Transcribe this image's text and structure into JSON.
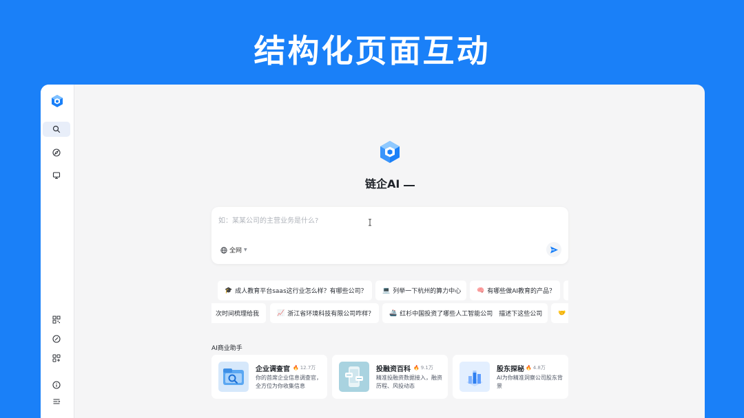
{
  "banner": {
    "title": "结构化页面互动"
  },
  "sidebar": {
    "top_items": [
      {
        "icon": "search-icon",
        "active": true
      },
      {
        "icon": "compass-icon",
        "active": false
      },
      {
        "icon": "monitor-icon",
        "active": false
      }
    ],
    "bottom_items": [
      {
        "icon": "qr-code-icon"
      },
      {
        "icon": "link-icon"
      },
      {
        "icon": "apps-add-icon"
      },
      {
        "icon": "info-icon"
      },
      {
        "icon": "menu-icon"
      }
    ]
  },
  "brand": {
    "name": "链企AI"
  },
  "search": {
    "placeholder": "如：某某公司的主营业务是什么?",
    "scope_label": "全网"
  },
  "suggestions": {
    "row1": [
      {
        "emoji": "🎓",
        "text": "成人教育平台saas这行业怎么样？有哪些公司？"
      },
      {
        "emoji": "💻",
        "text": "列举一下杭州的算力中心"
      },
      {
        "emoji": "🧠",
        "text": "有哪些做AI教育的产品？"
      }
    ],
    "row2": [
      {
        "emoji": "",
        "text": "次时间梳理给我"
      },
      {
        "emoji": "📈",
        "text": "浙江省环境科技有限公司咋样？"
      },
      {
        "emoji": "🚢",
        "text": "红杉中国投资了哪些人工智能公司　描述下这些公司"
      },
      {
        "emoji": "🤝",
        "text": ""
      }
    ]
  },
  "assistants": {
    "label": "AI商业助手",
    "cards": [
      {
        "title": "企业调查官",
        "hot": "12.7万",
        "desc": "你的首席企业信息调查官，全方位为你收集信息",
        "icon": "folder-search-icon"
      },
      {
        "title": "投融资百科",
        "hot": "9.1万",
        "desc": "精准投融资数据接入，融资历程、风投动态",
        "icon": "phone-chat-icon"
      },
      {
        "title": "股东探秘",
        "hot": "4.8万",
        "desc": "AI为你精准洞察公司股东背景",
        "icon": "bar-chart-icon"
      }
    ]
  },
  "colors": {
    "accent": "#1a80f8",
    "hot": "#f04b3a"
  }
}
